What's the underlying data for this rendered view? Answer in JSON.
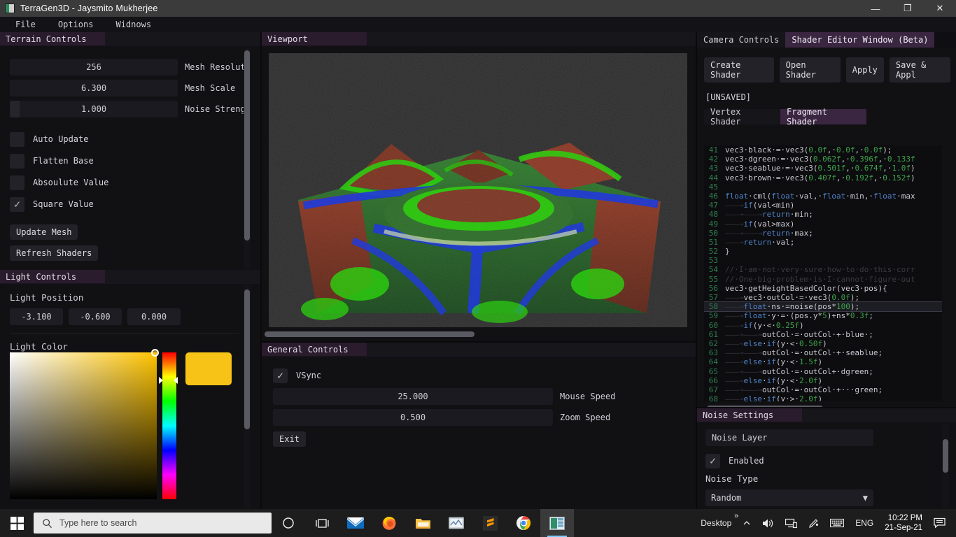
{
  "window": {
    "title": "TerraGen3D - Jaysmito Mukherjee",
    "minimize": "—",
    "maximize": "❐",
    "close": "✕"
  },
  "menu": {
    "items": [
      "File",
      "Options",
      "Widnows"
    ]
  },
  "terrain_panel": {
    "title": "Terrain Controls",
    "sliders": [
      {
        "value": "256",
        "label": "Mesh Resolut",
        "fill_pct": 0
      },
      {
        "value": "6.300",
        "label": "Mesh Scale",
        "fill_pct": 0
      },
      {
        "value": "1.000",
        "label": "Noise Streng",
        "fill_pct": 6
      }
    ],
    "checkboxes": [
      {
        "label": "Auto Update",
        "checked": false
      },
      {
        "label": "Flatten Base",
        "checked": false
      },
      {
        "label": "Absoulute Value",
        "checked": false
      },
      {
        "label": "Square Value",
        "checked": true
      }
    ],
    "buttons": [
      "Update Mesh",
      "Refresh Shaders"
    ]
  },
  "light_panel": {
    "title": "Light Controls",
    "position_label": "Light Position",
    "position": [
      "-3.100",
      "-0.600",
      "0.000"
    ],
    "color_label": "Light Color",
    "swatch_color": "#f6c316"
  },
  "viewport_panel": {
    "title": "Viewport"
  },
  "general_panel": {
    "title": "General Controls",
    "vsync": {
      "label": "VSync",
      "checked": true
    },
    "sliders": [
      {
        "value": "25.000",
        "label": "Mouse Speed"
      },
      {
        "value": "0.500",
        "label": "Zoom Speed"
      }
    ],
    "exit_button": "Exit"
  },
  "shader_panel": {
    "tabs": [
      {
        "label": "Camera Controls",
        "active": false
      },
      {
        "label": "Shader Editor Window (Beta)",
        "active": true
      }
    ],
    "buttons": [
      "Create Shader",
      "Open Shader",
      "Apply",
      "Save & Appl"
    ],
    "status": "[UNSAVED]",
    "code_tabs": [
      {
        "label": "Vertex Shader",
        "active": false
      },
      {
        "label": "Fragment Shader",
        "active": true
      }
    ],
    "code_lines": [
      {
        "n": "41",
        "current": false,
        "parts": [
          {
            "t": "vec3·black·=·vec3(",
            "c": "pl"
          },
          {
            "t": "0.0f",
            "c": "num"
          },
          {
            "t": ",·",
            "c": "pl"
          },
          {
            "t": "0.0f",
            "c": "num"
          },
          {
            "t": ",·",
            "c": "pl"
          },
          {
            "t": "0.0f",
            "c": "num"
          },
          {
            "t": ");",
            "c": "pl"
          }
        ]
      },
      {
        "n": "42",
        "current": false,
        "parts": [
          {
            "t": "vec3·dgreen·=·vec3(",
            "c": "pl"
          },
          {
            "t": "0.062f",
            "c": "num"
          },
          {
            "t": ",·",
            "c": "pl"
          },
          {
            "t": "0.396f",
            "c": "num"
          },
          {
            "t": ",·",
            "c": "pl"
          },
          {
            "t": "0.133f",
            "c": "num"
          }
        ]
      },
      {
        "n": "43",
        "current": false,
        "parts": [
          {
            "t": "vec3·seablue·=·vec3(",
            "c": "pl"
          },
          {
            "t": "0.501f",
            "c": "num"
          },
          {
            "t": ",·",
            "c": "pl"
          },
          {
            "t": "0.674f",
            "c": "num"
          },
          {
            "t": ",·",
            "c": "pl"
          },
          {
            "t": "1.0f",
            "c": "num"
          },
          {
            "t": ")",
            "c": "pl"
          }
        ]
      },
      {
        "n": "44",
        "current": false,
        "parts": [
          {
            "t": "vec3·brown·=·vec3(",
            "c": "pl"
          },
          {
            "t": "0.407f",
            "c": "num"
          },
          {
            "t": ",·",
            "c": "pl"
          },
          {
            "t": "0.192f",
            "c": "num"
          },
          {
            "t": ",·",
            "c": "pl"
          },
          {
            "t": "0.152f",
            "c": "num"
          },
          {
            "t": ")",
            "c": "pl"
          }
        ]
      },
      {
        "n": "45",
        "current": false,
        "parts": []
      },
      {
        "n": "46",
        "current": false,
        "parts": [
          {
            "t": "float",
            "c": "kw"
          },
          {
            "t": "·cml(",
            "c": "pl"
          },
          {
            "t": "float",
            "c": "kw"
          },
          {
            "t": "·val,·",
            "c": "pl"
          },
          {
            "t": "float",
            "c": "kw"
          },
          {
            "t": "·min,·",
            "c": "pl"
          },
          {
            "t": "float",
            "c": "kw"
          },
          {
            "t": "·max",
            "c": "pl"
          }
        ]
      },
      {
        "n": "47",
        "current": false,
        "parts": [
          {
            "t": "———→",
            "c": "tab-ar"
          },
          {
            "t": "if",
            "c": "kw"
          },
          {
            "t": "(val<min)",
            "c": "pl"
          }
        ]
      },
      {
        "n": "48",
        "current": false,
        "parts": [
          {
            "t": "———→———→",
            "c": "tab-ar"
          },
          {
            "t": "return",
            "c": "kw"
          },
          {
            "t": "·min;",
            "c": "pl"
          }
        ]
      },
      {
        "n": "49",
        "current": false,
        "parts": [
          {
            "t": "———→",
            "c": "tab-ar"
          },
          {
            "t": "if",
            "c": "kw"
          },
          {
            "t": "(val>max)",
            "c": "pl"
          }
        ]
      },
      {
        "n": "50",
        "current": false,
        "parts": [
          {
            "t": "———→———→",
            "c": "tab-ar"
          },
          {
            "t": "return",
            "c": "kw"
          },
          {
            "t": "·max;",
            "c": "pl"
          }
        ]
      },
      {
        "n": "51",
        "current": false,
        "parts": [
          {
            "t": "———→",
            "c": "tab-ar"
          },
          {
            "t": "return",
            "c": "kw"
          },
          {
            "t": "·val;",
            "c": "pl"
          }
        ]
      },
      {
        "n": "52",
        "current": false,
        "parts": [
          {
            "t": "}",
            "c": "pl"
          }
        ]
      },
      {
        "n": "53",
        "current": false,
        "parts": []
      },
      {
        "n": "54",
        "current": false,
        "parts": [
          {
            "t": "//·I·am·not·very·sure·how·to·do·this·corr",
            "c": "cmt"
          }
        ]
      },
      {
        "n": "55",
        "current": false,
        "parts": [
          {
            "t": "//·One·big·problem·is·I·cannot·figure·out",
            "c": "cmt"
          }
        ]
      },
      {
        "n": "56",
        "current": false,
        "parts": [
          {
            "t": "vec3·getHeightBasedColor(vec3·pos){",
            "c": "pl"
          }
        ]
      },
      {
        "n": "57",
        "current": false,
        "parts": [
          {
            "t": "———→",
            "c": "tab-ar"
          },
          {
            "t": "vec3·outCol·=·vec3(",
            "c": "pl"
          },
          {
            "t": "0.0f",
            "c": "num"
          },
          {
            "t": ");",
            "c": "pl"
          }
        ]
      },
      {
        "n": "58",
        "current": true,
        "parts": [
          {
            "t": "———→",
            "c": "tab-ar"
          },
          {
            "t": "float",
            "c": "kw"
          },
          {
            "t": "·ns·=noise(pos*",
            "c": "pl"
          },
          {
            "t": "100",
            "c": "num"
          },
          {
            "t": ");",
            "c": "pl"
          }
        ]
      },
      {
        "n": "59",
        "current": false,
        "parts": [
          {
            "t": "———→",
            "c": "tab-ar"
          },
          {
            "t": "float",
            "c": "kw"
          },
          {
            "t": "·y·=·(pos.y*",
            "c": "pl"
          },
          {
            "t": "5",
            "c": "num"
          },
          {
            "t": ")+ns*",
            "c": "pl"
          },
          {
            "t": "0.3f",
            "c": "num"
          },
          {
            "t": ";",
            "c": "pl"
          }
        ]
      },
      {
        "n": "60",
        "current": false,
        "parts": [
          {
            "t": "———→",
            "c": "tab-ar"
          },
          {
            "t": "if",
            "c": "kw"
          },
          {
            "t": "(y·<·",
            "c": "pl"
          },
          {
            "t": "0.25f",
            "c": "num"
          },
          {
            "t": ")",
            "c": "pl"
          }
        ]
      },
      {
        "n": "61",
        "current": false,
        "parts": [
          {
            "t": "———→———→",
            "c": "tab-ar"
          },
          {
            "t": "outCol·=·outCol·+·blue·;",
            "c": "pl"
          }
        ]
      },
      {
        "n": "62",
        "current": false,
        "parts": [
          {
            "t": "———→",
            "c": "tab-ar"
          },
          {
            "t": "else",
            "c": "kw"
          },
          {
            "t": "·",
            "c": "pl"
          },
          {
            "t": "if",
            "c": "kw"
          },
          {
            "t": "(y·<·",
            "c": "pl"
          },
          {
            "t": "0.50f",
            "c": "num"
          },
          {
            "t": ")",
            "c": "pl"
          }
        ]
      },
      {
        "n": "63",
        "current": false,
        "parts": [
          {
            "t": "———→———→",
            "c": "tab-ar"
          },
          {
            "t": "outCol·=·outCol·+·seablue;",
            "c": "pl"
          }
        ]
      },
      {
        "n": "64",
        "current": false,
        "parts": [
          {
            "t": "———→",
            "c": "tab-ar"
          },
          {
            "t": "else",
            "c": "kw"
          },
          {
            "t": "·",
            "c": "pl"
          },
          {
            "t": "if",
            "c": "kw"
          },
          {
            "t": "(y·<·",
            "c": "pl"
          },
          {
            "t": "1.5f",
            "c": "num"
          },
          {
            "t": ")",
            "c": "pl"
          }
        ]
      },
      {
        "n": "65",
        "current": false,
        "parts": [
          {
            "t": "———→———→",
            "c": "tab-ar"
          },
          {
            "t": "outCol·=·outCol+·dgreen;",
            "c": "pl"
          }
        ]
      },
      {
        "n": "66",
        "current": false,
        "parts": [
          {
            "t": "———→",
            "c": "tab-ar"
          },
          {
            "t": "else",
            "c": "kw"
          },
          {
            "t": "·",
            "c": "pl"
          },
          {
            "t": "if",
            "c": "kw"
          },
          {
            "t": "(y·<·",
            "c": "pl"
          },
          {
            "t": "2.0f",
            "c": "num"
          },
          {
            "t": ")",
            "c": "pl"
          }
        ]
      },
      {
        "n": "67",
        "current": false,
        "parts": [
          {
            "t": "———→———→",
            "c": "tab-ar"
          },
          {
            "t": "outCol·=·outCol·+···green;",
            "c": "pl"
          }
        ]
      },
      {
        "n": "68",
        "current": false,
        "parts": [
          {
            "t": "———→",
            "c": "tab-ar"
          },
          {
            "t": "else",
            "c": "kw"
          },
          {
            "t": "·",
            "c": "pl"
          },
          {
            "t": "if",
            "c": "kw"
          },
          {
            "t": "(y·>·",
            "c": "pl"
          },
          {
            "t": "2.0f",
            "c": "num"
          },
          {
            "t": ")",
            "c": "pl"
          }
        ]
      }
    ]
  },
  "noise_panel": {
    "title": "Noise Settings",
    "layer_field": "Noise Layer",
    "enabled": {
      "label": "Enabled",
      "checked": true
    },
    "type_label": "Noise Type",
    "type_value": "Random",
    "chevron": "▼"
  },
  "taskbar": {
    "search_placeholder": "Type here to search",
    "apps": [
      "cortana-icon",
      "task-view-icon",
      "mail-icon",
      "firefox-icon",
      "file-explorer-icon",
      "photos-icon",
      "sublime-text-icon",
      "chrome-icon",
      "terragen3d-icon"
    ],
    "tray": {
      "desktop": "Desktop",
      "overflow": "»",
      "language": "ENG",
      "time": "10:22 PM",
      "date": "21-Sep-21"
    }
  }
}
